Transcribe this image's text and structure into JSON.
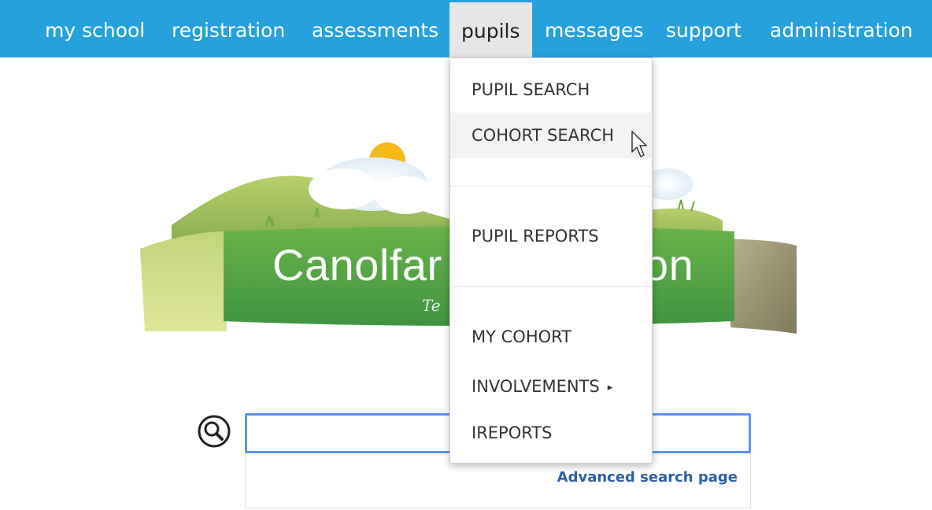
{
  "nav": {
    "items": [
      {
        "label": "my school"
      },
      {
        "label": "registration"
      },
      {
        "label": "assessments"
      },
      {
        "label": "pupils"
      },
      {
        "label": "messages"
      },
      {
        "label": "support"
      },
      {
        "label": "administration"
      }
    ],
    "active_item": "pupils"
  },
  "logo": {
    "text_left": "Canolfar",
    "text_right": "on",
    "tagline_fragment": "Te"
  },
  "dropdown": {
    "items": [
      {
        "label": "PUPIL SEARCH"
      },
      {
        "label": "COHORT SEARCH"
      },
      {
        "label": "PUPIL REPORTS"
      },
      {
        "label": "MY COHORT"
      },
      {
        "label": "INVOLVEMENTS",
        "has_submenu": true
      },
      {
        "label": "IREPORTS"
      }
    ],
    "hovered_item": "COHORT SEARCH",
    "submenu_caret": "▸"
  },
  "search": {
    "value": "",
    "advanced_link": "Advanced search page"
  },
  "icons": {
    "search": "magnifier-icon",
    "cursor": "mouse-pointer-icon",
    "submenu": "caret-right-icon"
  },
  "colors": {
    "nav_bar": "#27a1dc",
    "nav_active": "#e6e6e6",
    "input_border": "#5b94ee",
    "link": "#2d5ea7"
  }
}
